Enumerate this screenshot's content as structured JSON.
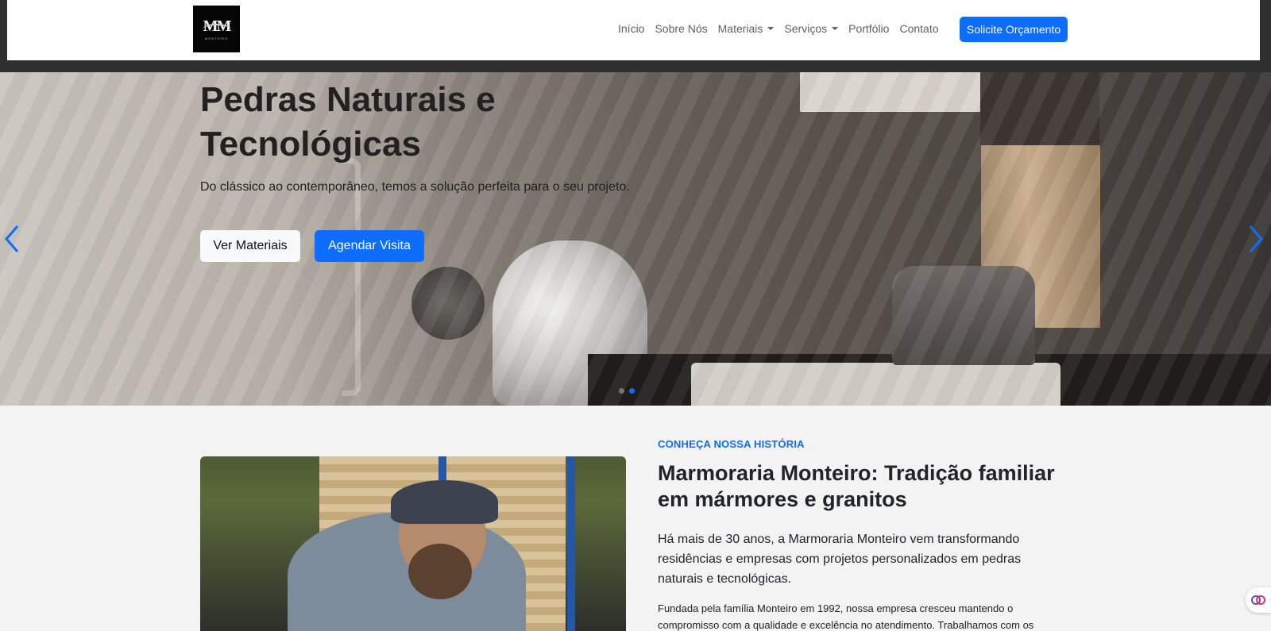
{
  "brand": {
    "logo_text": "MM",
    "logo_subtext": "MONTEIRO"
  },
  "nav": {
    "items": [
      {
        "label": "Início"
      },
      {
        "label": "Sobre Nós"
      },
      {
        "label": "Materiais"
      },
      {
        "label": "Serviços"
      },
      {
        "label": "Portfólio"
      },
      {
        "label": "Contato"
      }
    ],
    "cta": "Solicite Orçamento"
  },
  "hero": {
    "title": "Pedras Naturais e Tecnológicas",
    "subtitle": "Do clássico ao contemporâneo, temos a solução perfeita para o seu projeto.",
    "primary_button": "Ver Materiais",
    "secondary_button": "Agendar Visita"
  },
  "about": {
    "eyebrow": "CONHEÇA NOSSA HISTÓRIA",
    "title": "Marmoraria Monteiro: Tradição familiar em mármores e granitos",
    "lead": "Há mais de 30 anos, a Marmoraria Monteiro vem transformando residências e empresas com projetos personalizados em pedras naturais e tecnológicas.",
    "body": "Fundada pela família Monteiro em 1992, nossa empresa cresceu mantendo o compromisso com a qualidade e excelência no atendimento. Trabalhamos com os"
  },
  "colors": {
    "accent": "#0d6efd",
    "nav_text": "#5f5f5f",
    "section_bg": "#f3f3f3"
  }
}
